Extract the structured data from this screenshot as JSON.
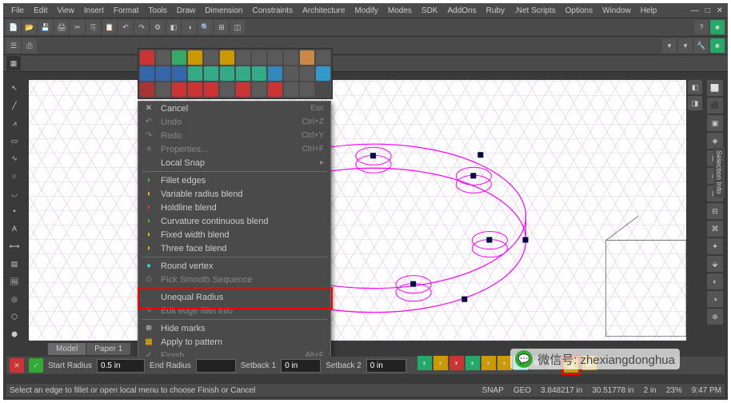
{
  "menubar": [
    "File",
    "Edit",
    "View",
    "Insert",
    "Format",
    "Tools",
    "Draw",
    "Dimension",
    "Constraints",
    "Architecture",
    "Modify",
    "Modes",
    "SDK",
    "AddOns",
    "Ruby",
    ".Net Scripts",
    "Options",
    "Window",
    "Help"
  ],
  "ctx": {
    "cancel": "Cancel",
    "esc": "Esc",
    "undo": "Undo",
    "undo_sc": "Ctrl+Z",
    "redo": "Redo",
    "redo_sc": "Ctrl+Y",
    "properties": "Properties...",
    "properties_sc": "Ctrl+F",
    "localsnap": "Local Snap",
    "fillet": "Fillet edges",
    "variable": "Variable radius blend",
    "holdline": "Holdline blend",
    "curvature": "Curvature continuous blend",
    "fixedwidth": "Fixed width blend",
    "threeface": "Three face blend",
    "roundvertex": "Round vertex",
    "picksmooth": "Pick Smooth Sequence",
    "unequal": "Unequal Radius",
    "editfillet": "Edit edge fillet info",
    "hidemarks": "Hide marks",
    "apply": "Apply to pattern",
    "finish": "Finish",
    "finish_sc": "Alt+F"
  },
  "tabs": {
    "model": "Model",
    "paper": "Paper 1"
  },
  "params": {
    "start_radius_label": "Start Radius",
    "start_radius": "0.5 in",
    "end_radius_label": "End Radius",
    "setback1_label": "Setback 1",
    "setback1": "0 in",
    "setback2_label": "Setback 2",
    "setback2": "0 in"
  },
  "status": {
    "hint": "Select an edge to fillet or open local menu to choose Finish or Cancel",
    "snap": "SNAP",
    "geo": "GEO",
    "x": "3.848217 in",
    "y": "30.51778 in",
    "z": "2 in",
    "page": "23%",
    "time": "9:47 PM"
  },
  "watermark": {
    "label": "微信号: zhexiangdonghua"
  },
  "side": {
    "sel": "Selection Info"
  }
}
